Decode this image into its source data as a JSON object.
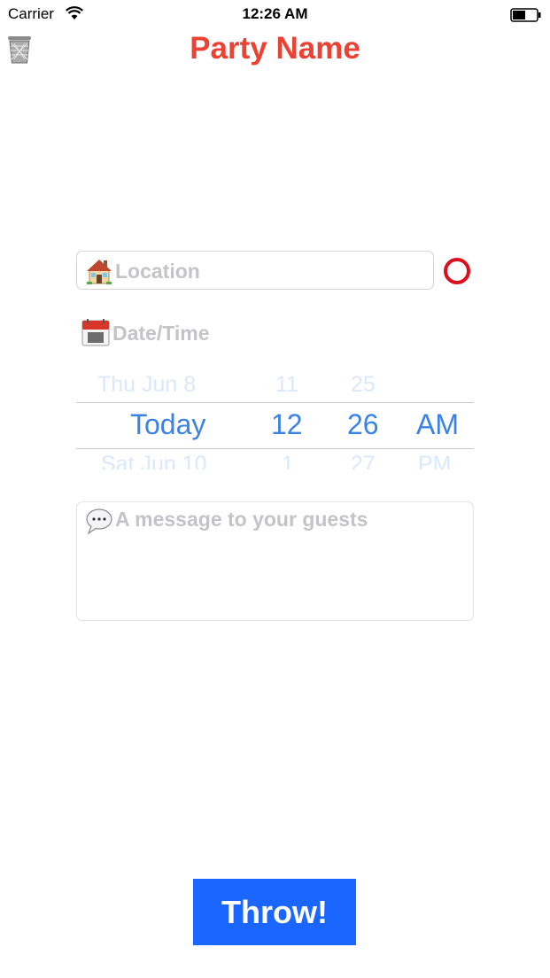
{
  "status_bar": {
    "carrier": "Carrier",
    "time": "12:26 AM"
  },
  "header": {
    "title": "Party Name"
  },
  "location": {
    "placeholder": "Location"
  },
  "datetime": {
    "label": "Date/Time",
    "picker": {
      "above": {
        "day": "Thu Jun 8",
        "hour": "11",
        "minute": "25"
      },
      "selected": {
        "day": "Today",
        "hour": "12",
        "minute": "26",
        "period": "AM"
      },
      "below": {
        "day": "Sat Jun 10",
        "hour": "1",
        "minute": "27",
        "period": "PM"
      }
    }
  },
  "message": {
    "placeholder": "A message to your guests"
  },
  "actions": {
    "throw_label": "Throw!"
  },
  "colors": {
    "title": "#ec4133",
    "accent": "#3b82e6",
    "button": "#1a66ff",
    "status_ring": "#dc0f1c"
  }
}
